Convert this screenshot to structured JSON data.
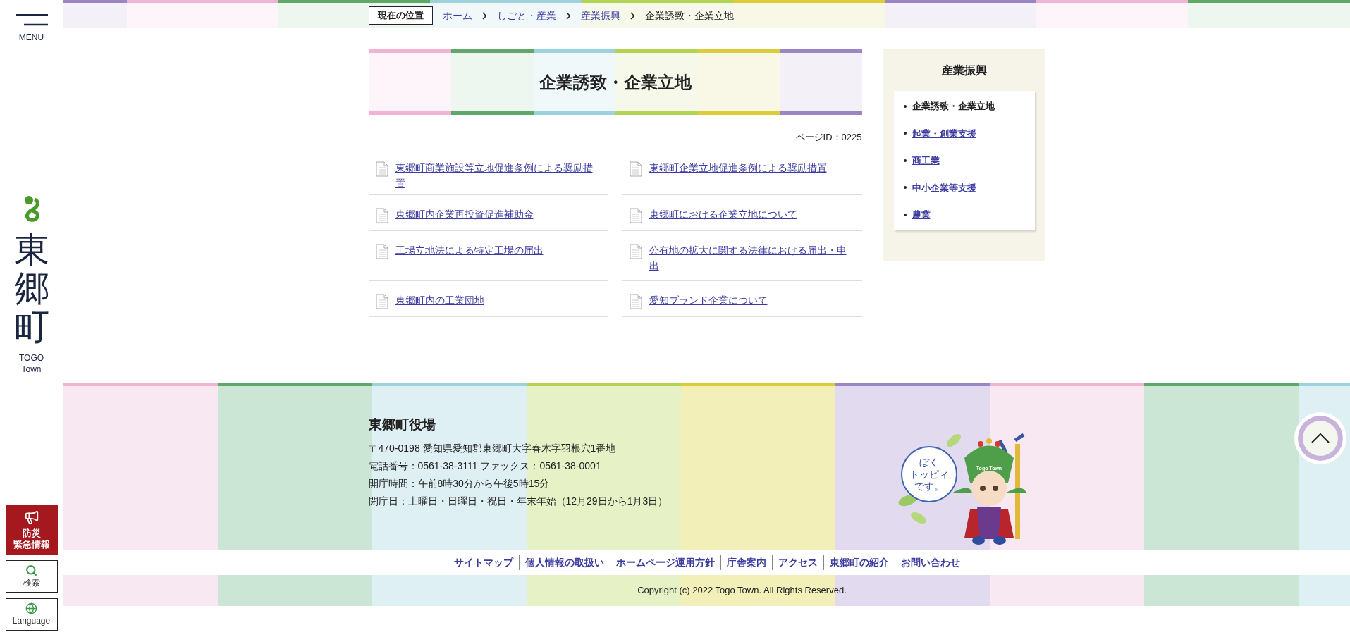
{
  "sidebar": {
    "menu_label": "MENU",
    "logo_text": "東郷町",
    "logo_subtitle": [
      "TOGO",
      "Town"
    ],
    "buttons": [
      {
        "kind": "emergency",
        "lines": [
          "防災",
          "緊急情報"
        ]
      },
      {
        "kind": "search",
        "lines": [
          "検索"
        ]
      },
      {
        "kind": "language",
        "lines": [
          "Language"
        ]
      }
    ]
  },
  "breadcrumb": {
    "label": "現在の位置",
    "items": [
      {
        "text": "ホーム",
        "kind": "link"
      },
      {
        "text": "しごと・産業",
        "kind": "link"
      },
      {
        "text": "産業振興",
        "kind": "link"
      },
      {
        "text": "企業誘致・企業立地",
        "kind": "current"
      }
    ]
  },
  "page": {
    "title": "企業誘致・企業立地",
    "page_id": "ページID：0225",
    "links": [
      "東郷町商業施設等立地促進条例による奨励措置",
      "東郷町企業立地促進条例による奨励措置",
      "東郷町内企業再投資促進補助金",
      "東郷町における企業立地について",
      "工場立地法による特定工場の届出",
      "公有地の拡大に関する法律における届出・申出",
      "東郷町内の工業団地",
      "愛知ブランド企業について"
    ]
  },
  "side_nav": {
    "title": "産業振興",
    "items": [
      {
        "text": "企業誘致・企業立地",
        "selected": true
      },
      {
        "text": "起業・創業支援",
        "selected": false
      },
      {
        "text": "商工業",
        "selected": false
      },
      {
        "text": "中小企業等支援",
        "selected": false
      },
      {
        "text": "農業",
        "selected": false
      }
    ]
  },
  "footer": {
    "name": "東郷町役場",
    "lines": [
      "〒470-0198 愛知県愛知郡東郷町大字春木字羽根穴1番地",
      "電話番号：0561-38-3111 ファックス：0561-38-0001",
      "開庁時間：午前8時30分から午後5時15分",
      "閉庁日：土曜日・日曜日・祝日・年末年始（12月29日から1月3日）"
    ],
    "mascot_speech": [
      "ぼく",
      "トッピィ",
      "です。"
    ],
    "mascot_hat": "Togo Town",
    "links": [
      "サイトマップ",
      "個人情報の取扱い",
      "ホームページ運用方針",
      "庁舎案内",
      "アクセス",
      "東郷町の紹介",
      "お問い合わせ"
    ],
    "copyright": "Copyright (c) 2022 Togo Town. All Rights Reserved."
  }
}
